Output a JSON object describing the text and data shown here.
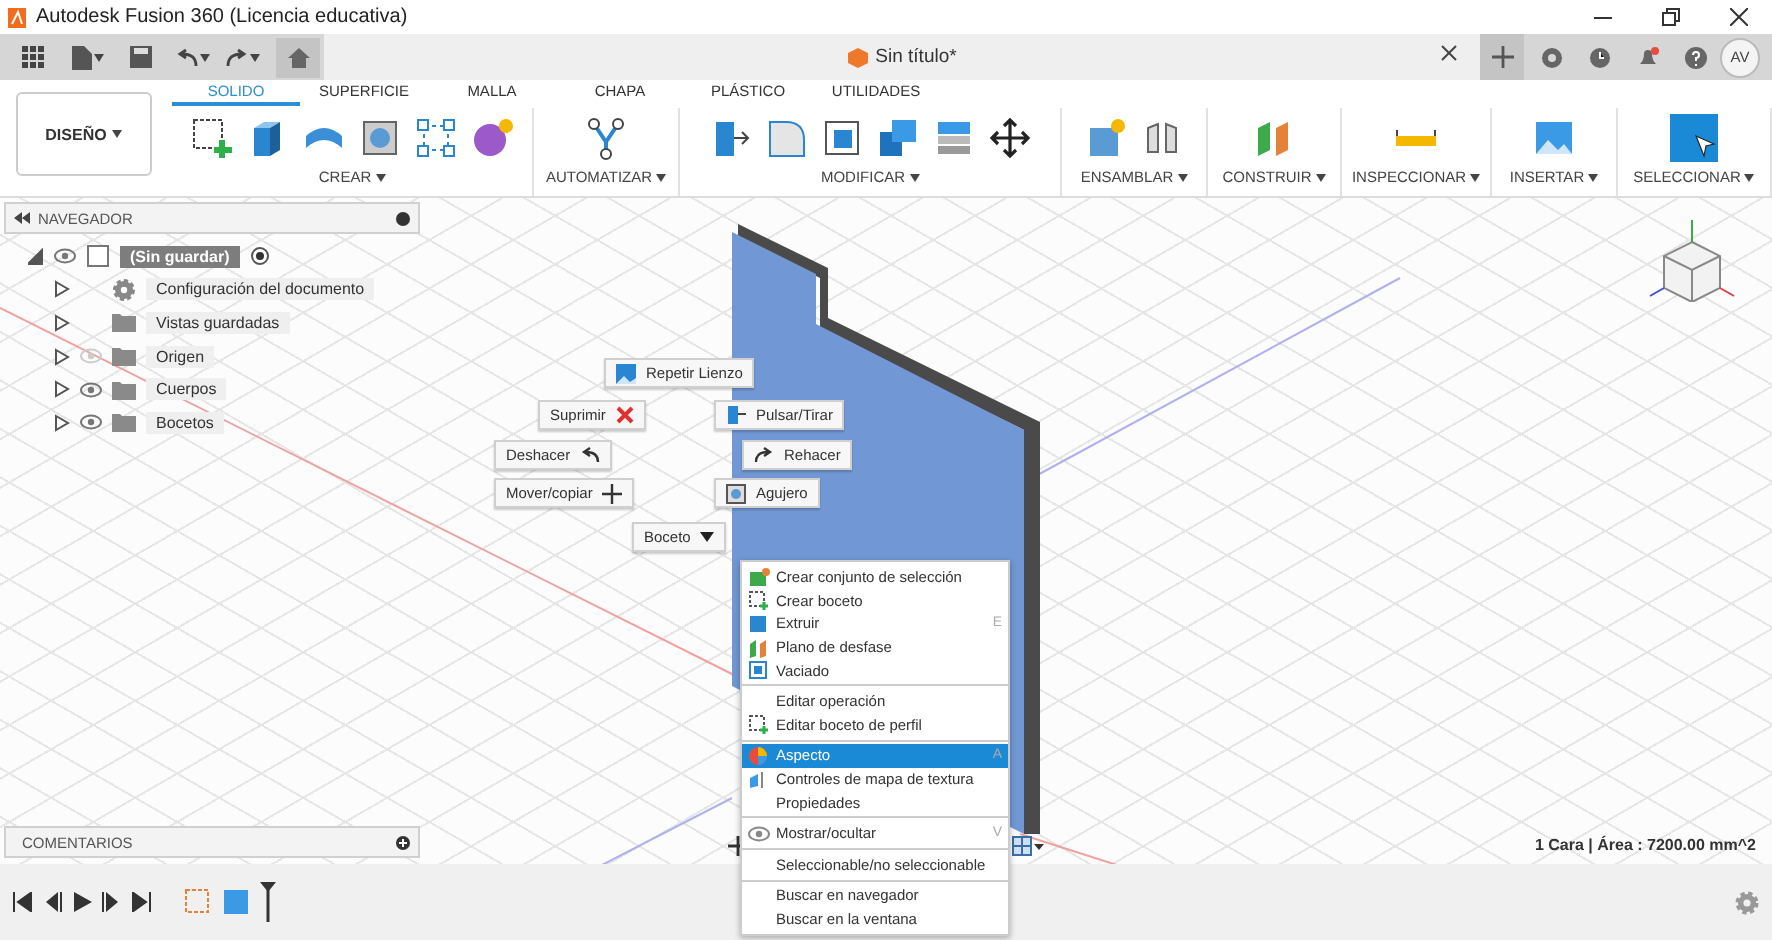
{
  "window": {
    "title": "Autodesk Fusion 360 (Licencia educativa)"
  },
  "document_tab": {
    "title": "Sin título*"
  },
  "user": {
    "initials": "AV"
  },
  "workspace": {
    "label": "DISEÑO"
  },
  "ribbon_tabs": [
    {
      "label": "SOLIDO",
      "selected": true
    },
    {
      "label": "SUPERFICIE",
      "selected": false
    },
    {
      "label": "MALLA",
      "selected": false
    },
    {
      "label": "CHAPA",
      "selected": false
    },
    {
      "label": "PLÁSTICO",
      "selected": false
    },
    {
      "label": "UTILIDADES",
      "selected": false
    }
  ],
  "tool_groups": [
    {
      "label": "CREAR"
    },
    {
      "label": "AUTOMATIZAR"
    },
    {
      "label": "MODIFICAR"
    },
    {
      "label": "ENSAMBLAR"
    },
    {
      "label": "CONSTRUIR"
    },
    {
      "label": "INSPECCIONAR"
    },
    {
      "label": "INSERTAR"
    },
    {
      "label": "SELECCIONAR"
    }
  ],
  "navigator": {
    "title": "NAVEGADOR",
    "tree": [
      {
        "label": "(Sin guardar)",
        "kind": "document",
        "visible": true,
        "expanded": true,
        "selected": true,
        "children": [
          {
            "label": "Configuración del documento",
            "kind": "settings",
            "expanded": false,
            "selected": false
          },
          {
            "label": "Vistas guardadas",
            "kind": "folder",
            "expanded": false,
            "selected": false
          },
          {
            "label": "Origen",
            "kind": "folder",
            "visible": false,
            "expanded": false,
            "selected": false
          },
          {
            "label": "Cuerpos",
            "kind": "bodies",
            "visible": true,
            "expanded": false,
            "selected": false
          },
          {
            "label": "Bocetos",
            "kind": "folder",
            "visible": true,
            "expanded": false,
            "selected": false
          }
        ]
      }
    ]
  },
  "comments": {
    "title": "COMENTARIOS"
  },
  "status": "1 Cara | Área : 7200.00 mm^2",
  "marking_menu": [
    {
      "label": "Repetir Lienzo",
      "kind": "canvas"
    },
    {
      "label": "Suprimir",
      "kind": "delete"
    },
    {
      "label": "Pulsar/Tirar",
      "kind": "pushpull"
    },
    {
      "label": "Deshacer",
      "kind": "undo"
    },
    {
      "label": "Rehacer",
      "kind": "redo"
    },
    {
      "label": "Mover/copiar",
      "kind": "move"
    },
    {
      "label": "Agujero",
      "kind": "hole"
    },
    {
      "label": "Boceto",
      "kind": "dropdown"
    }
  ],
  "context_menu": {
    "sections": [
      {
        "items": [
          {
            "label": "Crear conjunto de selección",
            "kind": "selection",
            "selected": false
          },
          {
            "label": "Crear boceto",
            "kind": "sketch",
            "selected": false
          },
          {
            "label": "Extruir",
            "kind": "extrude",
            "shortcut": "E",
            "selected": false
          },
          {
            "label": "Plano de desfase",
            "kind": "plane",
            "selected": false
          },
          {
            "label": "Vaciado",
            "kind": "shell",
            "selected": false
          }
        ]
      },
      {
        "items": [
          {
            "label": "Editar operación",
            "kind": "plain",
            "selected": false
          },
          {
            "label": "Editar boceto de perfil",
            "kind": "sketch",
            "selected": false
          }
        ]
      },
      {
        "items": [
          {
            "label": "Aspecto",
            "kind": "appearance",
            "shortcut": "A",
            "selected": true
          },
          {
            "label": "Controles de mapa de textura",
            "kind": "texture",
            "selected": false
          },
          {
            "label": "Propiedades",
            "kind": "plain",
            "selected": false
          }
        ]
      },
      {
        "items": [
          {
            "label": "Mostrar/ocultar",
            "kind": "eye",
            "shortcut": "V",
            "selected": false
          }
        ]
      },
      {
        "items": [
          {
            "label": "Seleccionable/no seleccionable",
            "kind": "plain",
            "selected": false
          }
        ]
      },
      {
        "items": [
          {
            "label": "Buscar en navegador",
            "kind": "plain",
            "selected": false
          },
          {
            "label": "Buscar en la ventana",
            "kind": "plain",
            "selected": false
          }
        ]
      }
    ]
  }
}
